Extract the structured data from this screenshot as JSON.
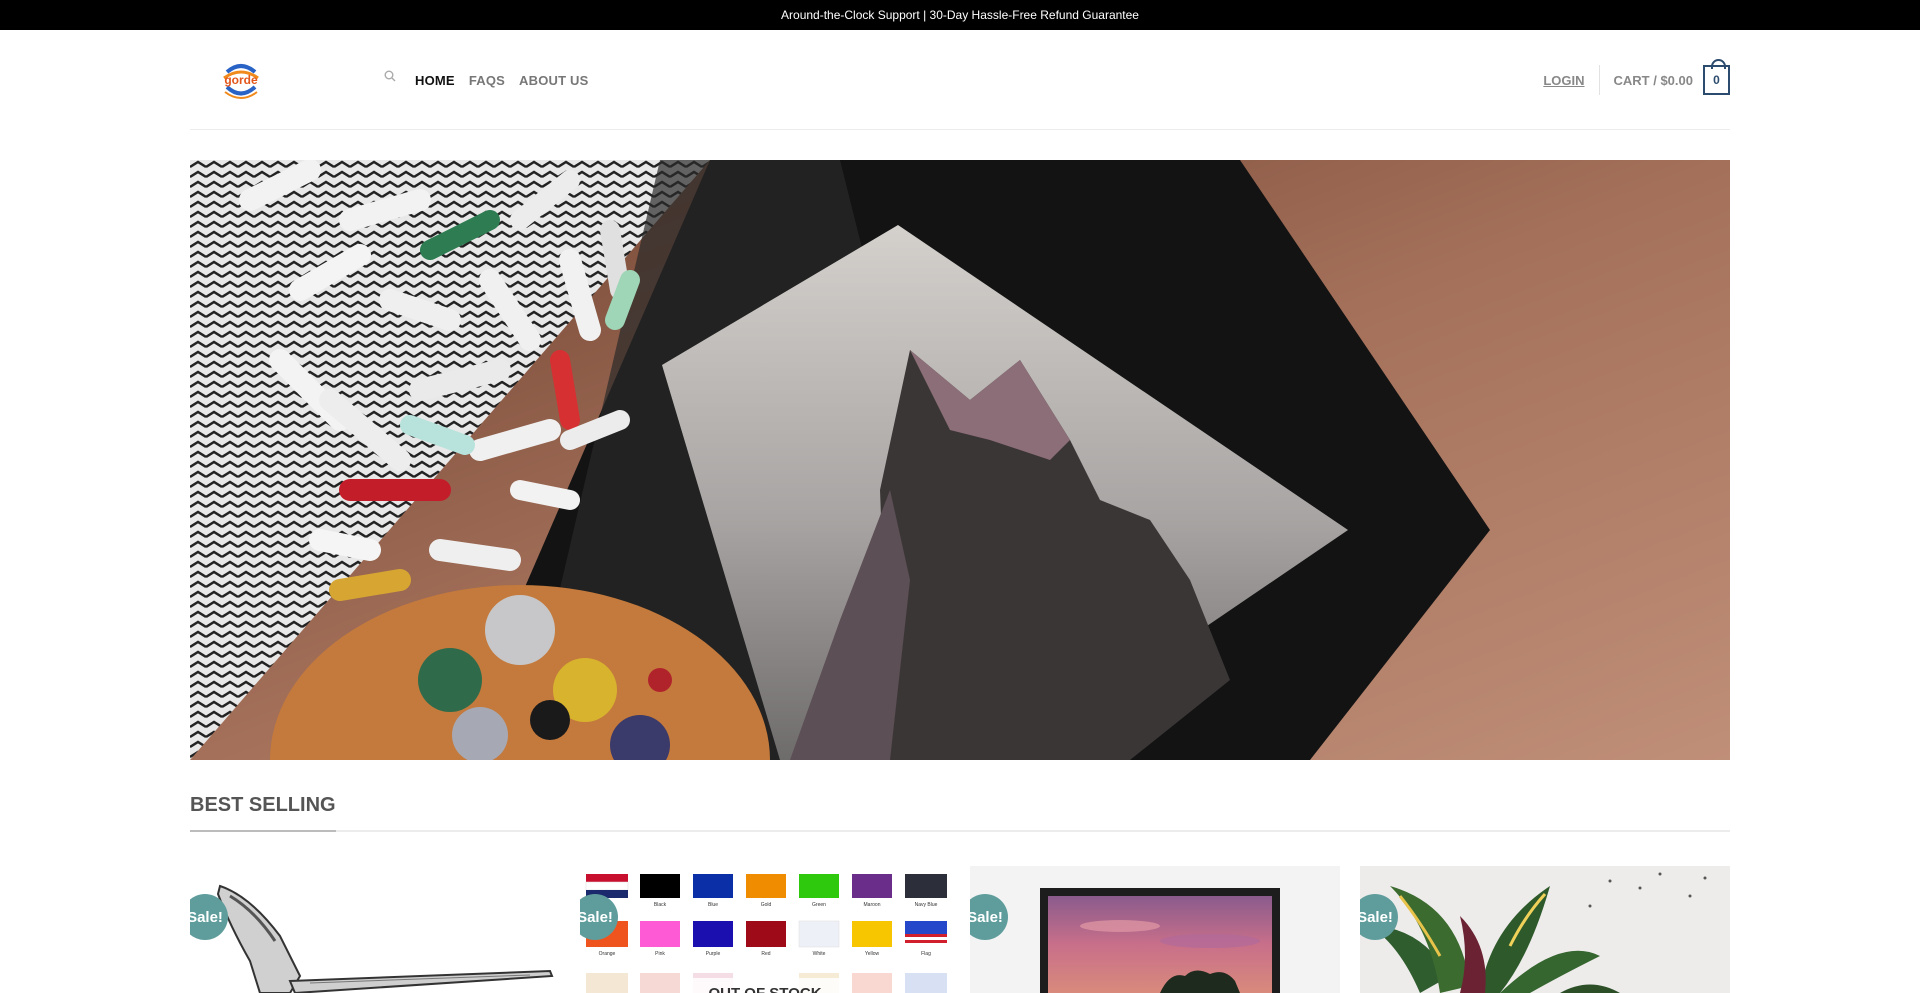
{
  "topbar": {
    "text": "Around-the-Clock Support | 30-Day Hassle-Free Refund Guarantee"
  },
  "logo": {
    "text": "gorde"
  },
  "nav": {
    "search_icon": "search-icon",
    "items": [
      {
        "label": "HOME",
        "active": true
      },
      {
        "label": "FAQS",
        "active": false
      },
      {
        "label": "ABOUT US",
        "active": false
      }
    ]
  },
  "account": {
    "login_label": "LOGIN"
  },
  "cart": {
    "label": "CART / $0.00",
    "count": "0"
  },
  "section": {
    "title": "BEST SELLING"
  },
  "products": [
    {
      "badge": "Sale!",
      "image": "vintage-knife-illustration"
    },
    {
      "badge": "Sale!",
      "image": "flag-color-swatches",
      "stock_label": "OUT OF STOCK",
      "swatch_labels": [
        "Black",
        "Blue",
        "Gold",
        "Green",
        "Maroon",
        "Navy Blue",
        "Orange",
        "Pink",
        "Purple",
        "Red",
        "White",
        "Yellow",
        "Flag"
      ]
    },
    {
      "badge": "Sale!",
      "image": "framed-sunset-painting"
    },
    {
      "badge": "Sale!",
      "image": "croton-plant-photo"
    }
  ],
  "colors": {
    "topbar_bg": "#000000",
    "sale_badge": "#5f9d9d",
    "cart_accent": "#2b4b6f"
  }
}
